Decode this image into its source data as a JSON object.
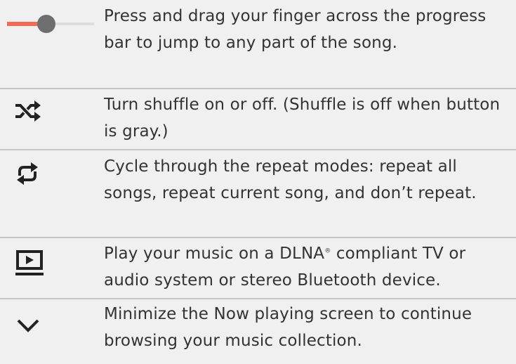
{
  "rows": [
    {
      "icon": "progress-slider-icon",
      "text": "Press and drag your finger across the progress bar to jump to any part of the song.",
      "slider_progress": 0.45,
      "slider_played_color": "#f26b54",
      "slider_track_color": "#dddddd",
      "slider_thumb_color": "#6e6e6e"
    },
    {
      "icon": "shuffle-icon",
      "text": "Turn shuffle on or off. (Shuffle is off when button is gray.)"
    },
    {
      "icon": "repeat-icon",
      "text": "Cycle through the repeat modes: repeat all songs, repeat current song, and don’t repeat."
    },
    {
      "icon": "cast-play-icon",
      "text_before": "Play your music on a DLNA",
      "text_mark": "®",
      "text_after": " compliant TV or audio system or stereo Bluetooth device."
    },
    {
      "icon": "chevron-down-icon",
      "text": "Minimize the Now playing screen to continue browsing your music collection."
    }
  ],
  "colors": {
    "row_background": "#f0f0f0",
    "separator": "#c6c6c6",
    "text": "#333333",
    "icon": "#222222"
  }
}
